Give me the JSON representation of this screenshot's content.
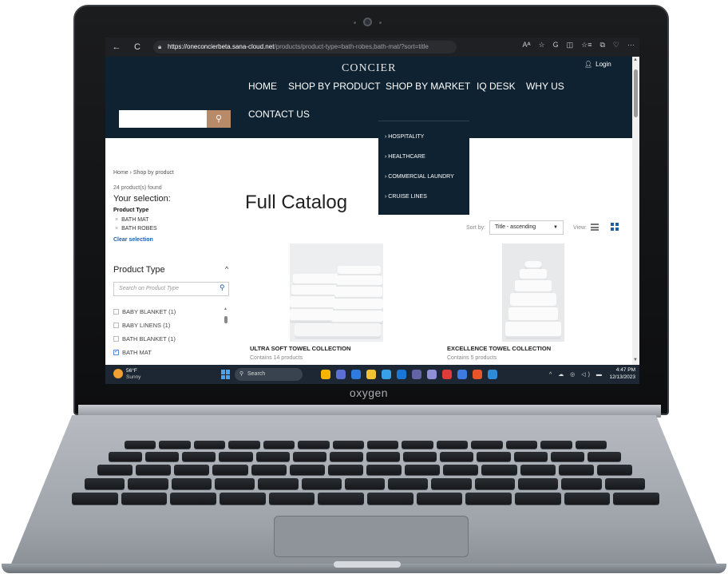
{
  "browser": {
    "back_icon": "←",
    "refresh_icon": "C",
    "url_host": "https://oneconcierbeta.sana-cloud.net",
    "url_path": "/products/product-type=bath-robes,bath-mat/?sort=title",
    "tool_icons": [
      "Aᴬ",
      "☆",
      "G",
      "◫",
      "☆≡",
      "⧉",
      "♡",
      "···"
    ]
  },
  "header": {
    "logo": "CONCIER",
    "login": "Login",
    "search_button_icon": "⚲",
    "menu": [
      "HOME",
      "SHOP BY PRODUCT",
      "SHOP BY MARKET",
      "IQ DESK",
      "WHY US",
      "CONTACT US"
    ],
    "market_dropdown": [
      "› HOSPITALITY",
      "› HEALTHCARE",
      "› COMMERCIAL LAUNDRY",
      "› CRUISE LINES"
    ]
  },
  "sidebar": {
    "breadcrumb": "Home › Shop by product",
    "found": "24 product(s) found",
    "your_selection": "Your selection:",
    "product_type_label": "Product Type",
    "selected": [
      "BATH MAT",
      "BATH ROBES"
    ],
    "clear": "Clear selection",
    "facet_title": "Product Type",
    "facet_toggle": "^",
    "facet_search_placeholder": "Search on Product Type",
    "facet_options": [
      {
        "label": "BABY BLANKET (1)",
        "checked": false
      },
      {
        "label": "BABY LINENS (1)",
        "checked": false
      },
      {
        "label": "BATH BLANKET (1)",
        "checked": false
      },
      {
        "label": "BATH MAT",
        "checked": true
      }
    ]
  },
  "catalog": {
    "title": "Full Catalog",
    "sort_label": "Sort by:",
    "sort_value": "Title - ascending",
    "view_label": "View:",
    "products": [
      {
        "name": "ULTRA SOFT TOWEL COLLECTION",
        "sub": "Contains 14 products"
      },
      {
        "name": "EXCELLENCE TOWEL COLLECTION",
        "sub": "Contains 5 products"
      }
    ]
  },
  "taskbar": {
    "temperature": "56°F",
    "weather": "Sunny",
    "search": "Search",
    "time": "4:47 PM",
    "date": "12/13/2023",
    "tray": "^ ☁ ◎ ◁) ▬",
    "app_colors": [
      "#f4b400",
      "#5b6fd6",
      "#2f7be0",
      "#f1c232",
      "#38a0e8",
      "#1a77d4",
      "#6264a7",
      "#8f8fd8",
      "#e03b3b",
      "#3d7be0",
      "#e9542a",
      "#2e8bd8"
    ]
  },
  "laptop": {
    "brand": "oxygen"
  }
}
